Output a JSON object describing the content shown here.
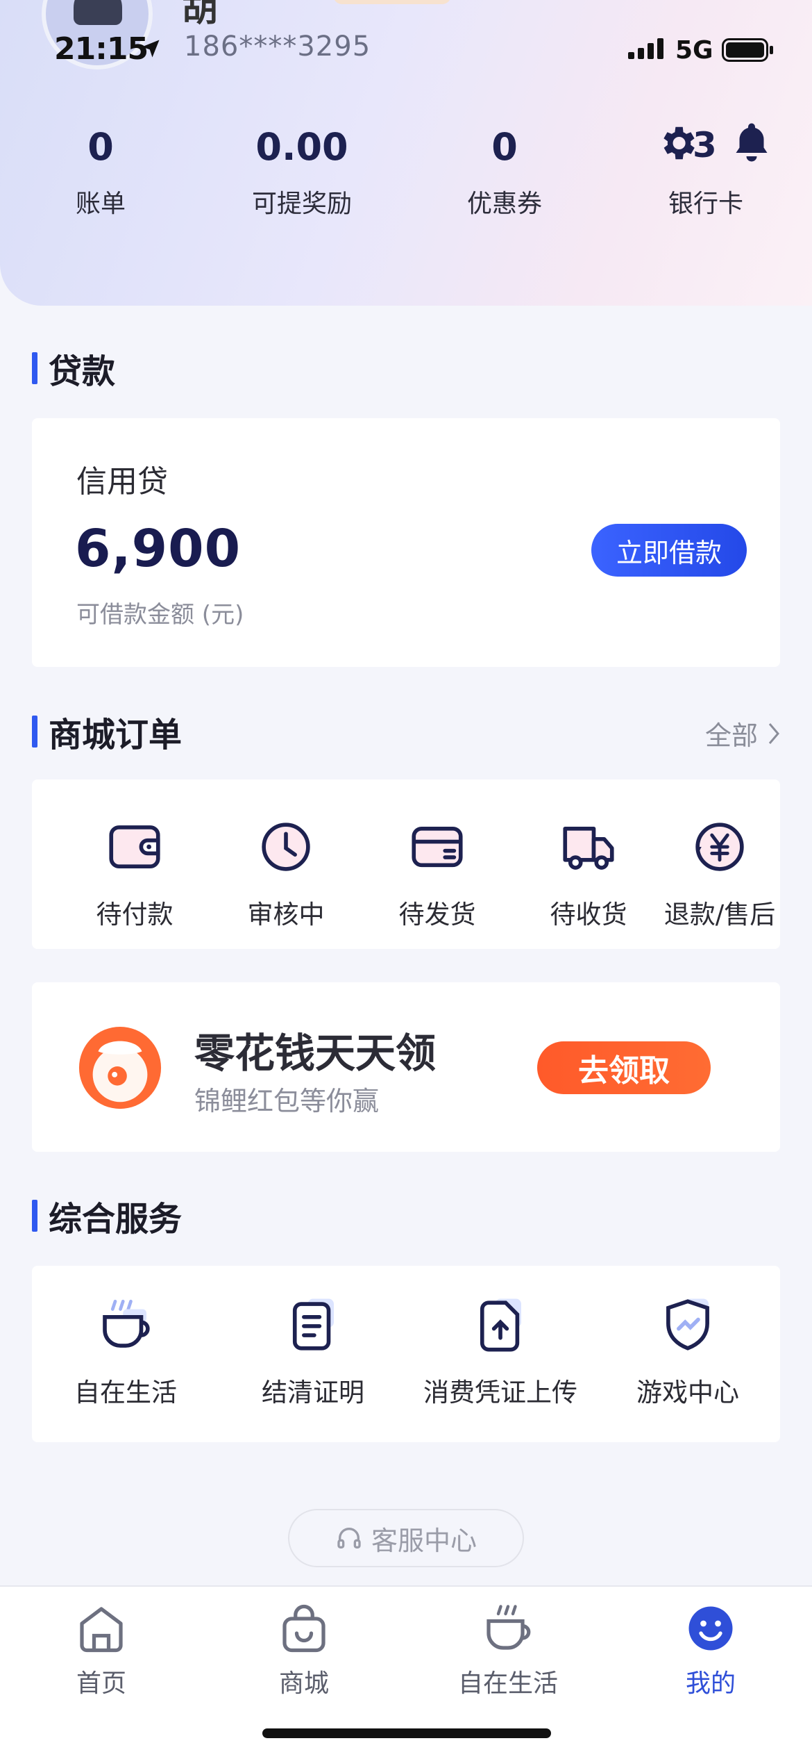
{
  "status_bar": {
    "time": "21:15",
    "network": "5G"
  },
  "profile": {
    "name_fragment": "胡",
    "phone": "186****3295"
  },
  "stats": [
    {
      "value": "0",
      "label": "账单"
    },
    {
      "value": "0.00",
      "label": "可提奖励"
    },
    {
      "value": "0",
      "label": "优惠券"
    },
    {
      "value": "3",
      "label": "银行卡"
    }
  ],
  "loan_section": {
    "title": "贷款",
    "product": "信用贷",
    "amount": "6,900",
    "amount_caption": "可借款金额 (元)",
    "button": "立即借款"
  },
  "orders_section": {
    "title": "商城订单",
    "more": "全部",
    "items": [
      {
        "label": "待付款",
        "icon": "wallet-icon"
      },
      {
        "label": "审核中",
        "icon": "clock-icon"
      },
      {
        "label": "待发货",
        "icon": "package-icon"
      },
      {
        "label": "待收货",
        "icon": "truck-icon"
      },
      {
        "label": "退款/售后",
        "icon": "refund-icon"
      }
    ]
  },
  "promo": {
    "title": "零花钱天天领",
    "subtitle": "锦鲤红包等你赢",
    "button": "去领取"
  },
  "services_section": {
    "title": "综合服务",
    "items": [
      {
        "label": "自在生活",
        "icon": "coffee-cup-icon"
      },
      {
        "label": "结清证明",
        "icon": "document-icon"
      },
      {
        "label": "消费凭证上传",
        "icon": "upload-file-icon"
      },
      {
        "label": "游戏中心",
        "icon": "shield-icon"
      }
    ]
  },
  "customer_service": {
    "label": "客服中心"
  },
  "tabbar": [
    {
      "label": "首页",
      "icon": "home-icon"
    },
    {
      "label": "商城",
      "icon": "shop-bag-icon"
    },
    {
      "label": "自在生活",
      "icon": "coffee-cup-icon"
    },
    {
      "label": "我的",
      "icon": "smiley-icon",
      "active": true
    }
  ],
  "colors": {
    "accent": "#2f59f0",
    "navy": "#191c50",
    "orange": "#ff5a2a",
    "background": "#f4f5fb"
  }
}
